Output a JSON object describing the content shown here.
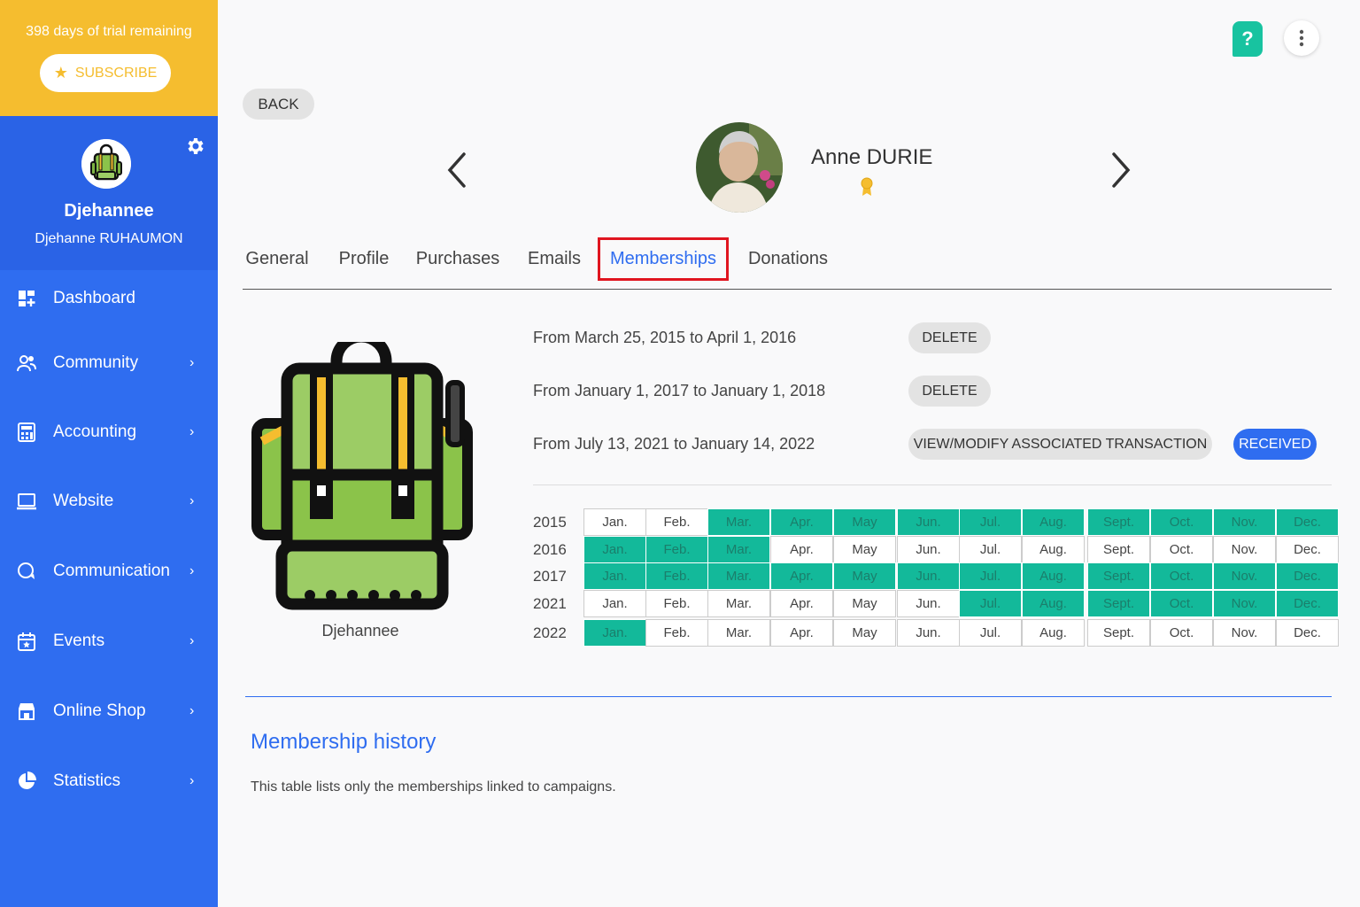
{
  "trial": {
    "text": "398 days of trial remaining",
    "subscribe_label": "SUBSCRIBE"
  },
  "account": {
    "name": "Djehannee",
    "full_name": "Djehanne RUHAUMON"
  },
  "nav": [
    {
      "label": "Dashboard",
      "icon": "dashboard-icon",
      "chevron": false
    },
    {
      "label": "Community",
      "icon": "community-icon",
      "chevron": true
    },
    {
      "label": "Accounting",
      "icon": "accounting-icon",
      "chevron": true
    },
    {
      "label": "Website",
      "icon": "website-icon",
      "chevron": true
    },
    {
      "label": "Communication",
      "icon": "communication-icon",
      "chevron": true
    },
    {
      "label": "Events",
      "icon": "events-icon",
      "chevron": true
    },
    {
      "label": "Online Shop",
      "icon": "online-shop-icon",
      "chevron": true
    },
    {
      "label": "Statistics",
      "icon": "statistics-icon",
      "chevron": true
    }
  ],
  "header": {
    "back_label": "BACK",
    "help_label": "?"
  },
  "person": {
    "name": "Anne DURIE"
  },
  "tabs": [
    "General",
    "Profile",
    "Purchases",
    "Emails",
    "Memberships",
    "Donations"
  ],
  "active_tab": "Memberships",
  "membership": {
    "caption": "Djehannee",
    "periods": [
      {
        "text": "From March 25, 2015 to April 1, 2016",
        "actions": [
          "DELETE"
        ]
      },
      {
        "text": "From January 1, 2017 to January 1, 2018",
        "actions": [
          "DELETE"
        ]
      },
      {
        "text": "From July 13, 2021 to January 14, 2022",
        "actions": [
          "VIEW/MODIFY ASSOCIATED TRANSACTION",
          "RECEIVED"
        ]
      }
    ]
  },
  "calendar": {
    "months": [
      "Jan.",
      "Feb.",
      "Mar.",
      "Apr.",
      "May",
      "Jun.",
      "Jul.",
      "Aug.",
      "Sept.",
      "Oct.",
      "Nov.",
      "Dec."
    ],
    "rows": [
      {
        "year": "2015",
        "paid": [
          false,
          false,
          true,
          true,
          true,
          true,
          true,
          true,
          true,
          true,
          true,
          true
        ]
      },
      {
        "year": "2016",
        "paid": [
          true,
          true,
          true,
          false,
          false,
          false,
          false,
          false,
          false,
          false,
          false,
          false
        ]
      },
      {
        "year": "2017",
        "paid": [
          true,
          true,
          true,
          true,
          true,
          true,
          true,
          true,
          true,
          true,
          true,
          true
        ]
      },
      {
        "year": "2021",
        "paid": [
          false,
          false,
          false,
          false,
          false,
          false,
          true,
          true,
          true,
          true,
          true,
          true
        ]
      },
      {
        "year": "2022",
        "paid": [
          true,
          false,
          false,
          false,
          false,
          false,
          false,
          false,
          false,
          false,
          false,
          false
        ]
      }
    ],
    "paid_color": "#13b99a"
  },
  "history": {
    "title": "Membership history",
    "description": "This table lists only the memberships linked to campaigns."
  },
  "colors": {
    "sidebar": "#2f6df0",
    "trial_banner": "#f5bd2f",
    "accent": "#2f6df0",
    "help": "#18c3a0",
    "active_tab_border": "#e0151f"
  }
}
